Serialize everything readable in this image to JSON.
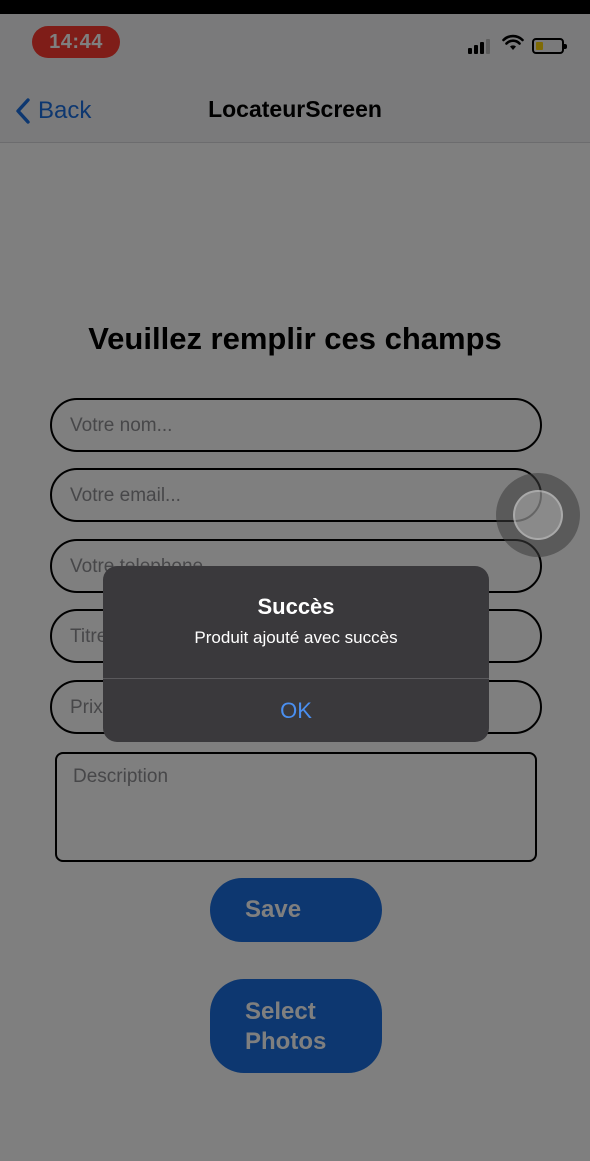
{
  "status_bar": {
    "time": "14:44"
  },
  "nav": {
    "back_label": "Back",
    "title": "LocateurScreen"
  },
  "form": {
    "heading": "Veuillez remplir ces champs",
    "name_placeholder": "Votre nom...",
    "email_placeholder": "Votre email...",
    "phone_placeholder": "Votre telephone...",
    "title_placeholder": "Titre...",
    "price_placeholder": "Prix...",
    "description_placeholder": "Description",
    "save_label": "Save",
    "select_photos_label": "Select Photos"
  },
  "alert": {
    "title": "Succès",
    "message": "Produit ajouté avec succès",
    "ok_label": "OK"
  },
  "colors": {
    "accent": "#1a6fe0",
    "time_pill": "#ff3b30",
    "alert_bg": "#3a393c",
    "alert_button": "#4a8ff0"
  },
  "icons": [
    "back-chevron-icon",
    "signal-icon",
    "wifi-icon",
    "battery-icon"
  ]
}
